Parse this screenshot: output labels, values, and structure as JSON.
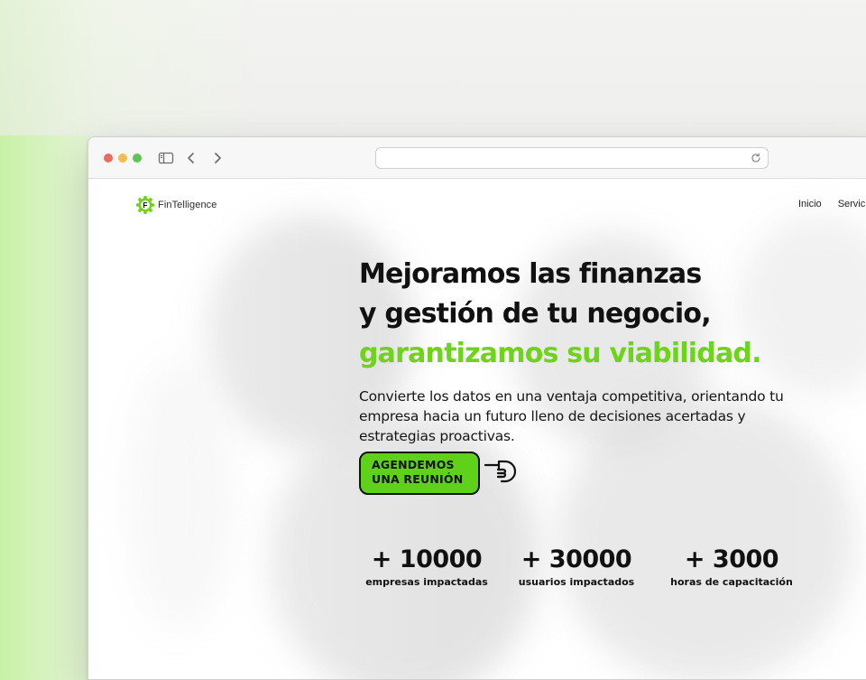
{
  "browser": {
    "address": "",
    "icons": {
      "sidebar": "sidebar-icon",
      "back": "chevron-left-icon",
      "forward": "chevron-right-icon",
      "reload": "reload-icon"
    },
    "traffic_lights": {
      "red": "#ef6b5f",
      "yellow": "#f4be4f",
      "green": "#5fc454"
    }
  },
  "site": {
    "logo_text": "FinTelligence",
    "logo_letter": "F",
    "accent_color": "#6ed31b",
    "nav": [
      "Inicio",
      "Servici"
    ]
  },
  "hero": {
    "title_line1": "Mejoramos las finanzas",
    "title_line2": "y gestión de tu negocio,",
    "title_accent": "garantizamos su viabilidad.",
    "subtitle": "Convierte los datos en una ventaja competitiva, orientando tu empresa hacia un futuro lleno de decisiones acertadas y estrategias proactivas.",
    "cta_line1": "AGENDEMOS",
    "cta_line2": "UNA REUNIÓN",
    "cta_icon": "pointing-hand-icon"
  },
  "stats": [
    {
      "value": "+ 10000",
      "label": "empresas impactadas"
    },
    {
      "value": "+ 30000",
      "label": "usuarios impactados"
    },
    {
      "value": "+ 3000",
      "label": "horas de capacitación"
    }
  ]
}
